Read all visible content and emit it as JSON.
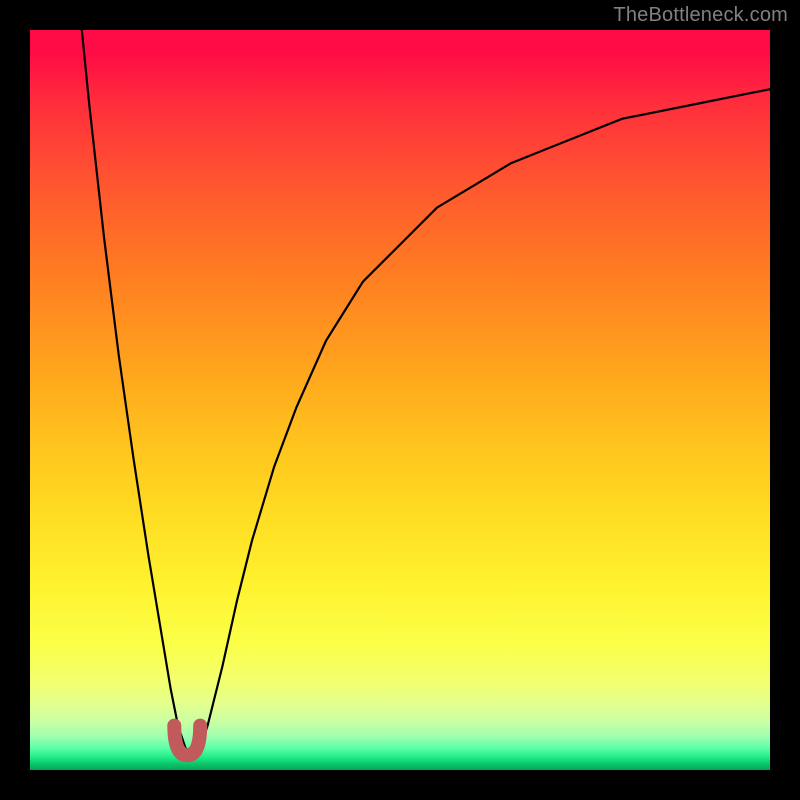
{
  "watermark": "TheBottleneck.com",
  "chart_data": {
    "type": "line",
    "title": "",
    "xlabel": "",
    "ylabel": "",
    "xlim": [
      0,
      100
    ],
    "ylim": [
      0,
      100
    ],
    "grid": false,
    "series": [
      {
        "name": "curve",
        "color": "#000000",
        "x": [
          7,
          8,
          10,
          12,
          14,
          16,
          18,
          19,
          20,
          21,
          22,
          23,
          24,
          26,
          28,
          30,
          33,
          36,
          40,
          45,
          50,
          55,
          60,
          65,
          70,
          75,
          80,
          85,
          90,
          95,
          100
        ],
        "y": [
          100,
          90,
          72,
          56,
          42,
          29,
          17,
          11,
          6,
          3,
          2,
          3,
          6,
          14,
          23,
          31,
          41,
          49,
          58,
          66,
          71,
          76,
          79,
          82,
          84,
          86,
          88,
          89,
          90,
          91,
          92
        ]
      }
    ],
    "markers": [
      {
        "name": "dip-marker",
        "shape": "u",
        "color": "#c15a5a",
        "x_range": [
          19.5,
          23
        ],
        "y_range": [
          2,
          6
        ]
      }
    ],
    "background_gradient": {
      "direction": "vertical",
      "stops": [
        {
          "pos": 0.0,
          "color": "#ff0b46"
        },
        {
          "pos": 0.33,
          "color": "#ff7d22"
        },
        {
          "pos": 0.67,
          "color": "#ffe024"
        },
        {
          "pos": 0.88,
          "color": "#f3ff6e"
        },
        {
          "pos": 0.97,
          "color": "#5effa8"
        },
        {
          "pos": 1.0,
          "color": "#08a656"
        }
      ]
    }
  }
}
